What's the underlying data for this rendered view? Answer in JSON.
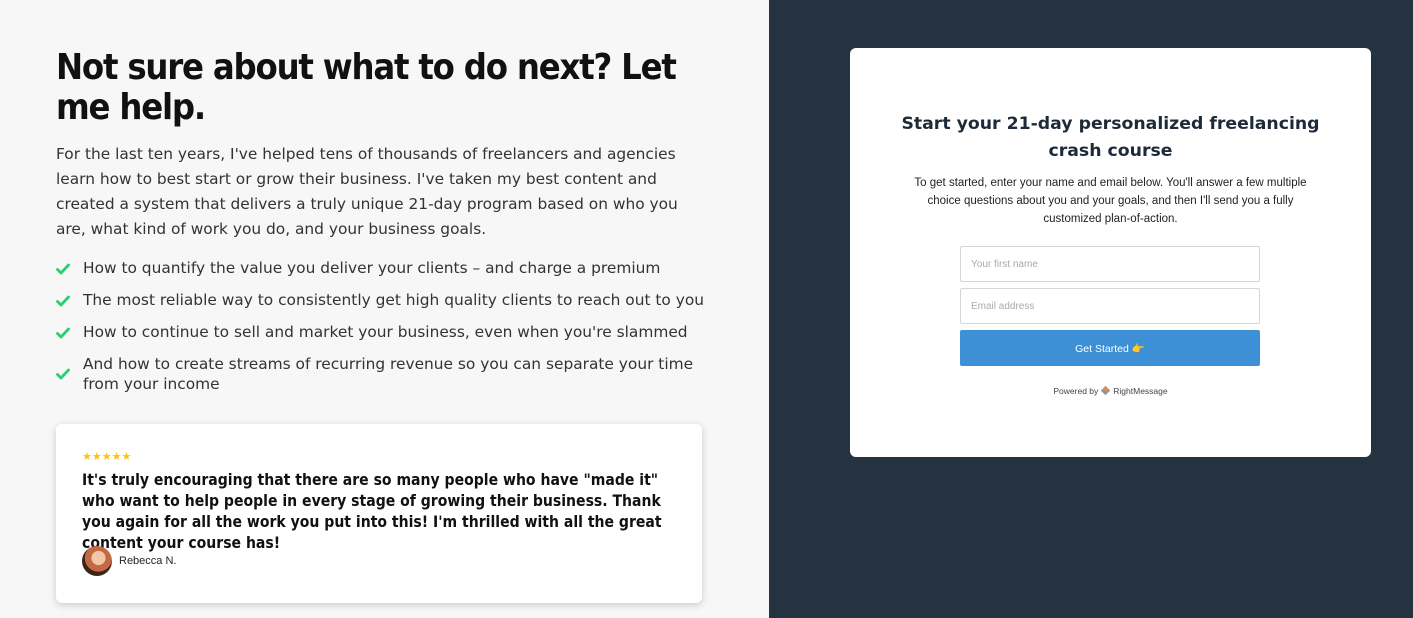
{
  "left": {
    "headline": "Not sure about what to do next? Let me help.",
    "intro": "For the last ten years, I've helped tens of thousands of freelancers and agencies learn how to best start or grow their business. I've taken my best content and created a system that delivers a truly unique 21-day program based on who you are, what kind of work you do, and your business goals.",
    "bullets": [
      "How to quantify the value you deliver your clients – and charge a premium",
      "The most reliable way to consistently get high quality clients to reach out to you",
      "How to continue to sell and market your business, even when you're slammed",
      "And how to create streams of recurring revenue so you can separate your time from your income"
    ],
    "testimonial": {
      "stars": "★★★★★",
      "rating": 5,
      "quote": "It's truly encouraging that there are so many people who have \"made it\" who want to help people in every stage of growing their business. Thank you again for all the work you put into this! I'm thrilled with all the great content your course has!",
      "author": "Rebecca N."
    }
  },
  "form": {
    "title": "Start your 21-day personalized freelancing crash course",
    "description": "To get started, enter your name and email below. You'll answer a few multiple choice questions about you and your goals, and then I'll send you a fully customized plan-of-action.",
    "first_name_placeholder": "Your first name",
    "email_placeholder": "Email address",
    "submit_label": "Get Started",
    "submit_emoji": "👉",
    "powered_prefix": "Powered by",
    "powered_brand": "RightMessage"
  },
  "colors": {
    "right_panel_bg": "#253341",
    "check_green": "#2ecc71",
    "button_blue": "#3d8fd6",
    "star_gold": "#f5c518"
  },
  "icons": [
    "check-icon",
    "star-icon",
    "pointing-hand-icon",
    "rightmessage-logo-icon"
  ]
}
